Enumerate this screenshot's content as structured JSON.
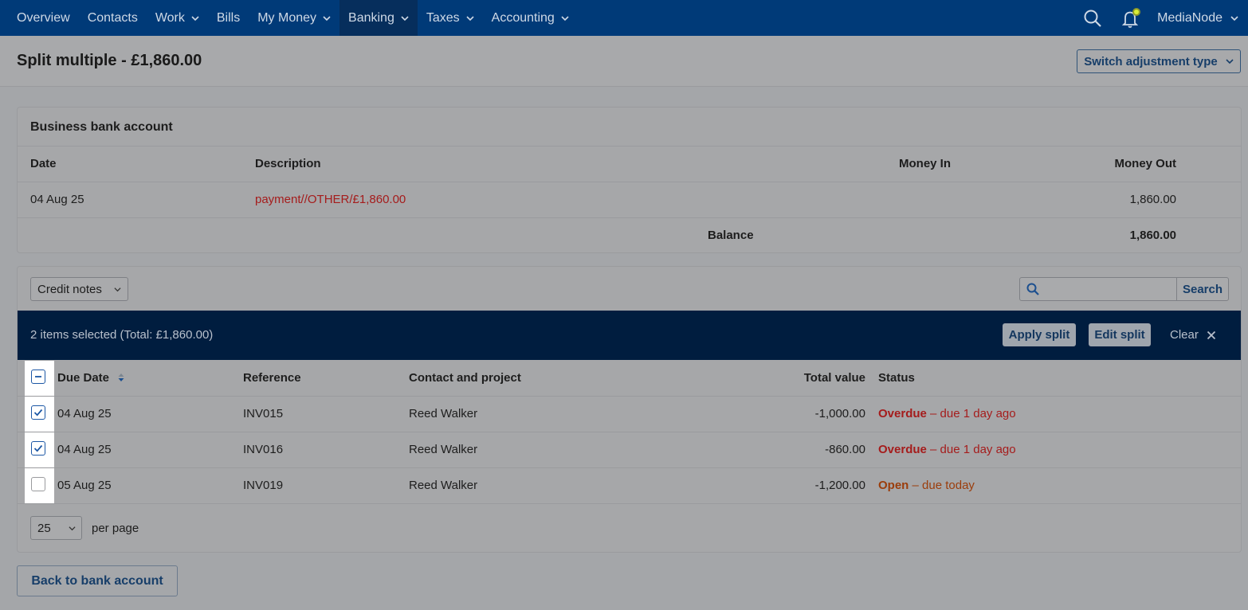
{
  "nav": {
    "items": [
      {
        "label": "Overview",
        "dropdown": false
      },
      {
        "label": "Contacts",
        "dropdown": false
      },
      {
        "label": "Work",
        "dropdown": true
      },
      {
        "label": "Bills",
        "dropdown": false
      },
      {
        "label": "My Money",
        "dropdown": true
      },
      {
        "label": "Banking",
        "dropdown": true,
        "active": true
      },
      {
        "label": "Taxes",
        "dropdown": true
      },
      {
        "label": "Accounting",
        "dropdown": true
      }
    ],
    "account": "MediaNode",
    "icons": [
      "search-icon",
      "bell-icon"
    ]
  },
  "header": {
    "title": "Split multiple - £1,860.00",
    "switch_label": "Switch adjustment type"
  },
  "bank": {
    "title": "Business bank account",
    "columns": {
      "date": "Date",
      "description": "Description",
      "money_in": "Money In",
      "money_out": "Money Out"
    },
    "row": {
      "date": "04 Aug 25",
      "description": "payment//OTHER/£1,860.00",
      "money_in": "",
      "money_out": "1,860.00"
    },
    "balance_label": "Balance",
    "balance_value": "1,860.00"
  },
  "filter": {
    "type_selected": "Credit notes",
    "search_placeholder": "",
    "search_label": "Search"
  },
  "selection": {
    "summary": "2 items selected (Total: £1,860.00)",
    "apply_label": "Apply split",
    "edit_label": "Edit split",
    "clear_label": "Clear"
  },
  "table": {
    "columns": {
      "due_date": "Due Date",
      "reference": "Reference",
      "contact": "Contact and project",
      "total": "Total value",
      "status": "Status"
    },
    "rows": [
      {
        "checked": true,
        "due_date": "04 Aug 25",
        "reference": "INV015",
        "contact": "Reed Walker",
        "total": "-1,000.00",
        "status_label": "Overdue",
        "status_detail": " – due 1 day ago",
        "status_kind": "overdue"
      },
      {
        "checked": true,
        "due_date": "04 Aug 25",
        "reference": "INV016",
        "contact": "Reed Walker",
        "total": "-860.00",
        "status_label": "Overdue",
        "status_detail": " – due 1 day ago",
        "status_kind": "overdue"
      },
      {
        "checked": false,
        "due_date": "05 Aug 25",
        "reference": "INV019",
        "contact": "Reed Walker",
        "total": "-1,200.00",
        "status_label": "Open",
        "status_detail": " – due today",
        "status_kind": "open"
      }
    ]
  },
  "pagination": {
    "per_page_value": "25",
    "per_page_label": "per page"
  },
  "footer": {
    "back_label": "Back to bank account"
  },
  "colors": {
    "nav_bg": "#003a78",
    "selection_bar": "#001d3f",
    "overdue": "#a51c1c",
    "open": "#9b3d0b",
    "checkbox": "#1c57a5"
  }
}
